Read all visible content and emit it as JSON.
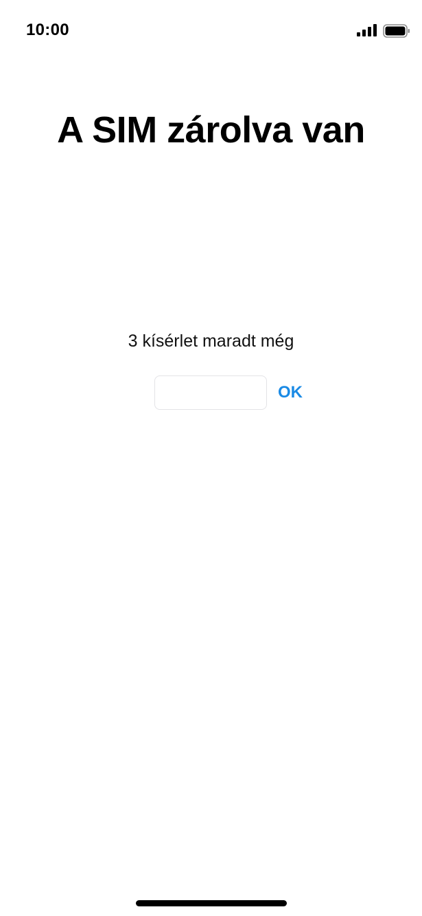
{
  "status_bar": {
    "time": "10:00",
    "signal_icon": "cellular-signal-icon",
    "battery_icon": "battery-icon"
  },
  "screen": {
    "title": "A SIM zárolva van",
    "attempts_text": "3 kísérlet maradt még",
    "pin_input": {
      "value": "",
      "placeholder": ""
    },
    "ok_label": "OK"
  },
  "colors": {
    "accent": "#1a8ae5",
    "background": "#ffffff",
    "text": "#000000"
  }
}
